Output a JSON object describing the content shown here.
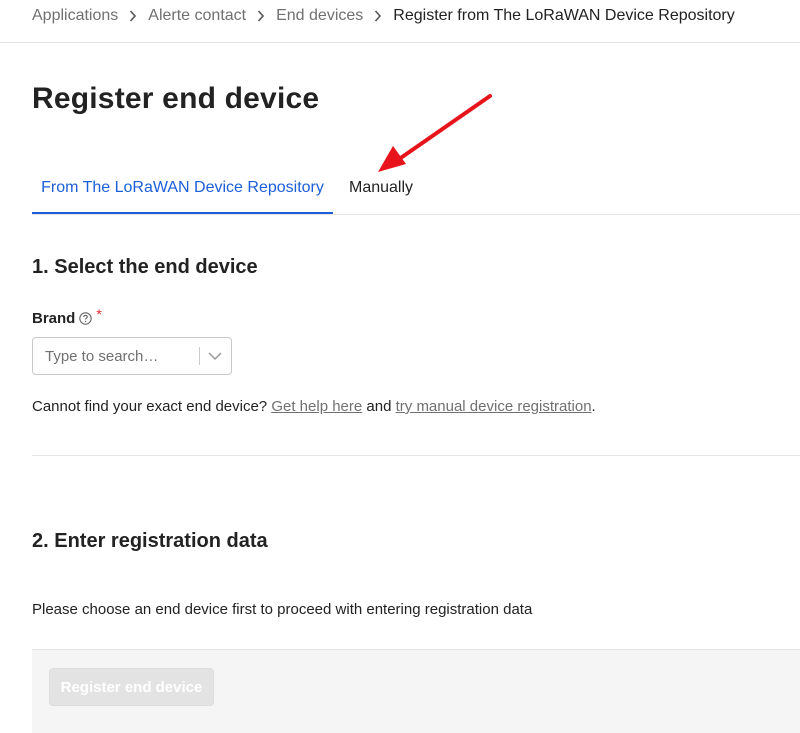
{
  "breadcrumb": {
    "items": [
      "Applications",
      "Alerte contact",
      "End devices"
    ],
    "current": "Register from The LoRaWAN Device Repository"
  },
  "page": {
    "title": "Register end device"
  },
  "tabs": [
    {
      "label": "From The LoRaWAN Device Repository",
      "active": true
    },
    {
      "label": "Manually",
      "active": false
    }
  ],
  "section1": {
    "title": "1. Select the end device",
    "brand_label": "Brand",
    "required_marker": "*",
    "brand_placeholder": "Type to search…",
    "help_prefix": "Cannot find your exact end device? ",
    "help_link": "Get help here",
    "help_middle": " and ",
    "manual_link": "try manual device registration",
    "help_suffix": "."
  },
  "section2": {
    "title": "2. Enter registration data",
    "info": "Please choose an end device first to proceed with entering registration data"
  },
  "footer": {
    "submit_label": "Register end device",
    "submit_disabled": true
  },
  "colors": {
    "accent": "#1c5fd8",
    "required": "#d62828",
    "annotation_arrow": "#e8141c"
  },
  "icons": {
    "breadcrumb_separator": "chevron-right-icon",
    "brand_help": "question-circle-icon",
    "select_dropdown": "chevron-down-icon",
    "annotation": "red-arrow-icon"
  }
}
